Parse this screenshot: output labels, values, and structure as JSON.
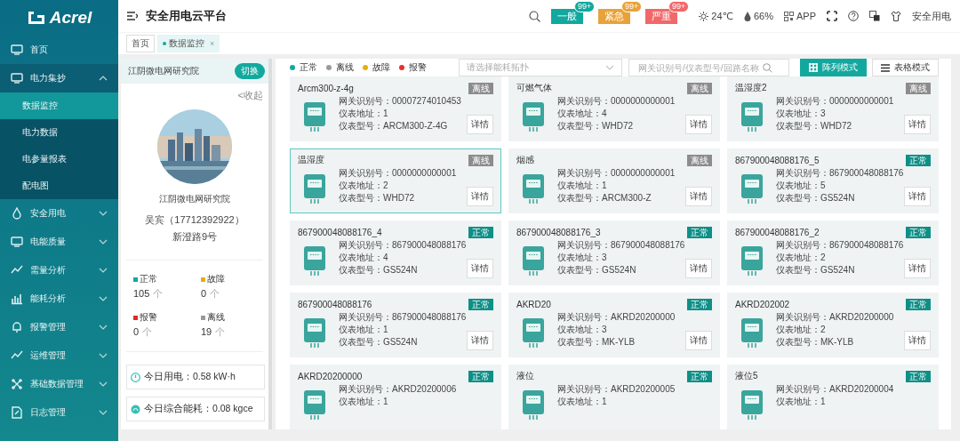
{
  "sidebar": {
    "logo": "Acrel",
    "items": [
      {
        "label": "首页",
        "expanded": false
      },
      {
        "label": "电力集抄",
        "expanded": true,
        "children": [
          {
            "label": "数据监控",
            "selected": true
          },
          {
            "label": "电力数据",
            "selected": false
          },
          {
            "label": "电参量报表",
            "selected": false
          },
          {
            "label": "配电图",
            "selected": false
          }
        ]
      },
      {
        "label": "安全用电",
        "expanded": false
      },
      {
        "label": "电能质量",
        "expanded": false
      },
      {
        "label": "需量分析",
        "expanded": false
      },
      {
        "label": "能耗分析",
        "expanded": false
      },
      {
        "label": "报警管理",
        "expanded": false
      },
      {
        "label": "运维管理",
        "expanded": false
      },
      {
        "label": "基础数据管理",
        "expanded": false
      },
      {
        "label": "日志管理",
        "expanded": false
      }
    ]
  },
  "header": {
    "title": "安全用电云平台",
    "alerts": [
      {
        "label": "一般",
        "count": "99+",
        "color": "#13a89e"
      },
      {
        "label": "紧急",
        "count": "99+",
        "color": "#e8a23a"
      },
      {
        "label": "严重",
        "count": "99+",
        "color": "#f0686a"
      }
    ],
    "temperature": "24℃",
    "humidity": "66%",
    "app": "APP",
    "user": "安全用电"
  },
  "tabs": [
    {
      "label": "首页",
      "selected": false
    },
    {
      "label": "数据监控",
      "selected": true,
      "close": "×"
    }
  ],
  "site_panel": {
    "name": "江阴微电网研究院",
    "switch": "切换",
    "collapse": "<收起",
    "site_name": "江阴微电网研究院",
    "contact": "吴宾（17712392922）",
    "address": "新澄路9号",
    "stats": [
      {
        "label": "正常",
        "value": "105",
        "unit": "个",
        "color": "#13a89e"
      },
      {
        "label": "故障",
        "value": "0",
        "unit": "个",
        "color": "#e5b000"
      },
      {
        "label": "报警",
        "value": "0",
        "unit": "个",
        "color": "#e02a2a"
      },
      {
        "label": "离线",
        "value": "19",
        "unit": "个",
        "color": "#999999"
      }
    ],
    "energy": [
      {
        "kind": "power",
        "text": "今日用电：0.58 kW·h"
      },
      {
        "kind": "energy",
        "text": "今日综合能耗：0.08 kgce"
      }
    ]
  },
  "legend": [
    {
      "label": "正常",
      "color": "#13a89e"
    },
    {
      "label": "离线",
      "color": "#9a9a9a"
    },
    {
      "label": "故障",
      "color": "#e5b000"
    },
    {
      "label": "报警",
      "color": "#e83030"
    }
  ],
  "toolbar": {
    "topology_placeholder": "请选择能耗拓扑",
    "search_placeholder": "网关识别号/仪表型号/回路名称",
    "views": [
      {
        "label": "阵列模式",
        "kind": "grid",
        "selected": true
      },
      {
        "label": "表格模式",
        "kind": "list",
        "selected": false
      }
    ]
  },
  "devices": [
    {
      "name": "Arcm300-z-4g",
      "color": "#8c8c8c",
      "status_label": "离线",
      "selected": false,
      "lines": [
        "网关识别号：00007274010453",
        "仪表地址：1",
        "仪表型号：ARCM300-Z-4G"
      ],
      "detail": "详情"
    },
    {
      "name": "可燃气体",
      "color": "#8c8c8c",
      "status_label": "离线",
      "selected": false,
      "lines": [
        "网关识别号：0000000000001",
        "仪表地址：4",
        "仪表型号：WHD72"
      ],
      "detail": "详情"
    },
    {
      "name": "温湿度2",
      "color": "#8c8c8c",
      "status_label": "离线",
      "selected": false,
      "lines": [
        "网关识别号：0000000000001",
        "仪表地址：3",
        "仪表型号：WHD72"
      ],
      "detail": "详情"
    },
    {
      "name": "温湿度",
      "color": "#8c8c8c",
      "status_label": "离线",
      "selected": true,
      "lines": [
        "网关识别号：0000000000001",
        "仪表地址：2",
        "仪表型号：WHD72"
      ],
      "detail": "详情"
    },
    {
      "name": "烟感",
      "color": "#8c8c8c",
      "status_label": "离线",
      "selected": false,
      "lines": [
        "网关识别号：0000000000001",
        "仪表地址：1",
        "仪表型号：ARCM300-Z"
      ],
      "detail": "详情"
    },
    {
      "name": "867900048088176_5",
      "color": "#0e8f87",
      "status_label": "正常",
      "selected": false,
      "lines": [
        "网关识别号：867900048088176",
        "仪表地址：5",
        "仪表型号：GS524N"
      ],
      "detail": "详情"
    },
    {
      "name": "867900048088176_4",
      "color": "#0e8f87",
      "status_label": "正常",
      "selected": false,
      "lines": [
        "网关识别号：867900048088176",
        "仪表地址：4",
        "仪表型号：GS524N"
      ],
      "detail": "详情"
    },
    {
      "name": "867900048088176_3",
      "color": "#0e8f87",
      "status_label": "正常",
      "selected": false,
      "lines": [
        "网关识别号：867900048088176",
        "仪表地址：3",
        "仪表型号：GS524N"
      ],
      "detail": "详情"
    },
    {
      "name": "867900048088176_2",
      "color": "#0e8f87",
      "status_label": "正常",
      "selected": false,
      "lines": [
        "网关识别号：867900048088176",
        "仪表地址：2",
        "仪表型号：GS524N"
      ],
      "detail": "详情"
    },
    {
      "name": "867900048088176",
      "color": "#0e8f87",
      "status_label": "正常",
      "selected": false,
      "lines": [
        "网关识别号：867900048088176",
        "仪表地址：1",
        "仪表型号：GS524N"
      ],
      "detail": "详情"
    },
    {
      "name": "AKRD20",
      "color": "#0e8f87",
      "status_label": "正常",
      "selected": false,
      "lines": [
        "网关识别号：AKRD20200000",
        "仪表地址：3",
        "仪表型号：MK-YLB"
      ],
      "detail": "详情"
    },
    {
      "name": "AKRD202002",
      "color": "#0e8f87",
      "status_label": "正常",
      "selected": false,
      "lines": [
        "网关识别号：AKRD20200000",
        "仪表地址：2",
        "仪表型号：MK-YLB"
      ],
      "detail": "详情"
    },
    {
      "name": "AKRD20200000",
      "color": "#0e8f87",
      "status_label": "正常",
      "selected": false,
      "lines": [
        "网关识别号：AKRD20200006",
        "仪表地址：1"
      ]
    },
    {
      "name": "液位",
      "color": "#0e8f87",
      "status_label": "正常",
      "selected": false,
      "lines": [
        "网关识别号：AKRD20200005",
        "仪表地址：1"
      ]
    },
    {
      "name": "液位5",
      "color": "#0e8f87",
      "status_label": "正常",
      "selected": false,
      "lines": [
        "网关识别号：AKRD20200004",
        "仪表地址：1"
      ]
    }
  ]
}
